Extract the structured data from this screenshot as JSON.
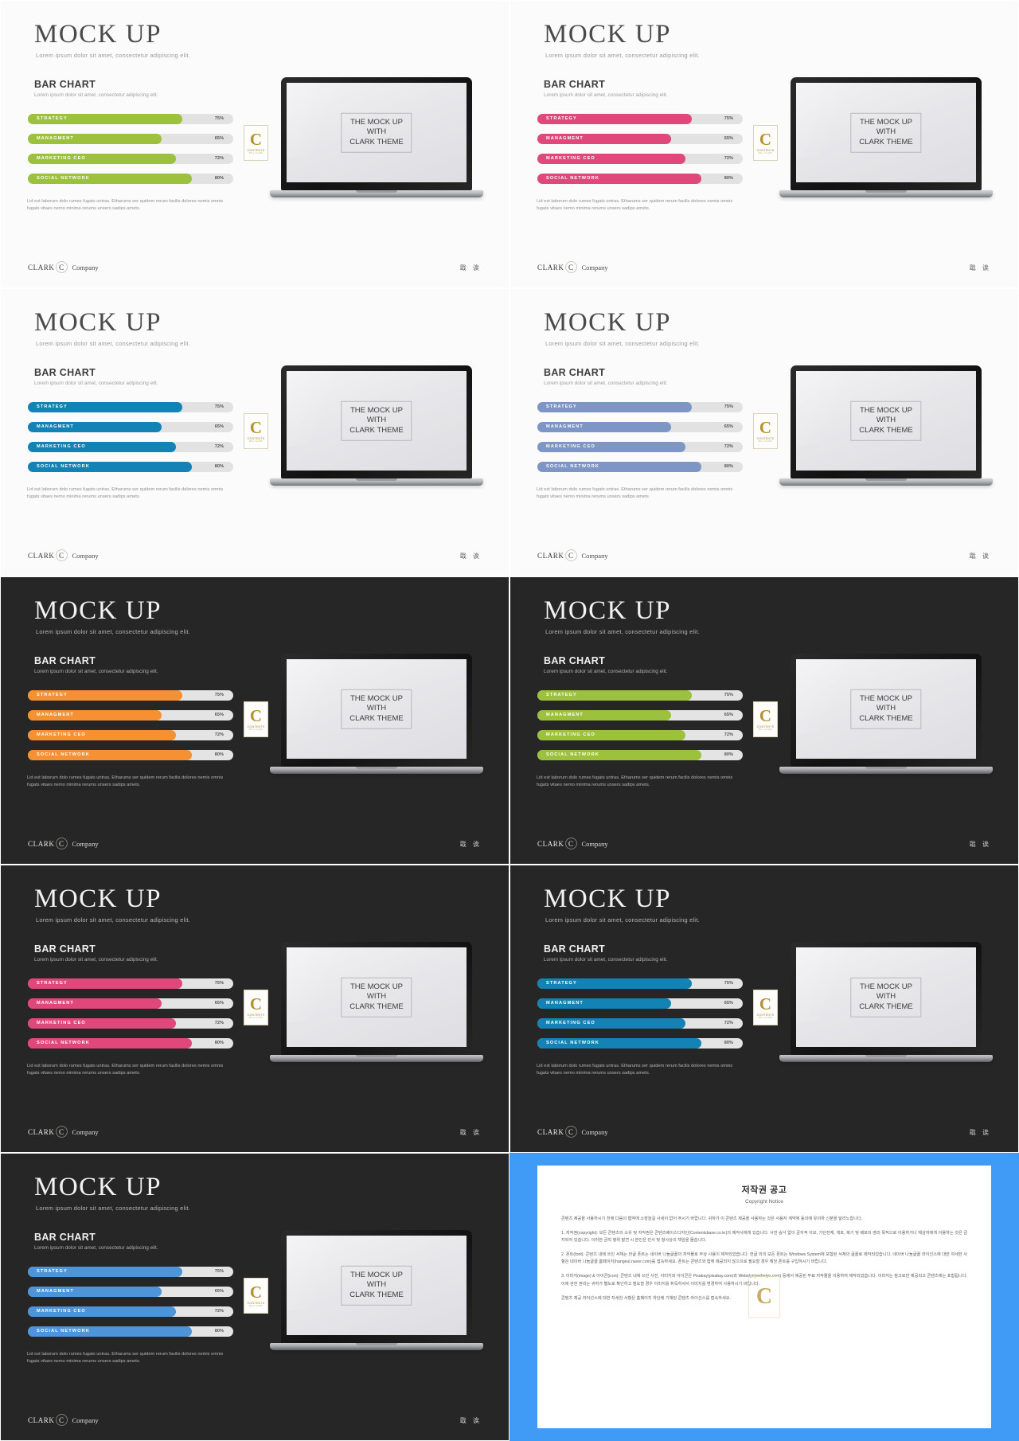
{
  "common": {
    "title": "MOCK UP",
    "subtitle": "Lorem ipsum dolor sit amet, consectetur adipiscing elit.",
    "chart_heading": "BAR CHART",
    "chart_sub": "Lorem ipsum dolor sit amet, consectetur adipiscing elit.",
    "footnote": "Lid est laborum dolo rumes fugats untras. Etharums ser quidem rerum facilis dolores nemis omnis fugats vitaes nemo minima rerums unsers sadips amets.",
    "screen_text": "THE MOCK UP\nWITH\nCLARK THEME",
    "logo_letter": "C",
    "logo_line1": "CONTENTS",
    "logo_line2": "WILL CLARK",
    "footer_brand": "CLARK",
    "footer_mark": "C",
    "footer_company": "Company",
    "footer_right": "戢 诶"
  },
  "chart_data": {
    "type": "bar",
    "title": "BAR CHART",
    "orientation": "horizontal",
    "categories": [
      "STRATEGY",
      "MANAGMENT",
      "MARKETING CEO",
      "SOCIAL NETWORK"
    ],
    "values": [
      75,
      65,
      72,
      80
    ],
    "value_labels": [
      "75%",
      "65%",
      "72%",
      "80%"
    ],
    "xlabel": "",
    "ylabel": "",
    "xlim": [
      0,
      100
    ],
    "grid": false,
    "legend": "none",
    "track_color": "#e2e2e2"
  },
  "slides": [
    {
      "id": "slide-1",
      "theme": "light",
      "accent": "#9cc13c",
      "bg": "#fbfbfb"
    },
    {
      "id": "slide-2",
      "theme": "light",
      "accent": "#e0487b",
      "bg": "#fbfbfb"
    },
    {
      "id": "slide-3",
      "theme": "light",
      "accent": "#1383b5",
      "bg": "#fbfbfb"
    },
    {
      "id": "slide-4",
      "theme": "light",
      "accent": "#7d96c6",
      "bg": "#fbfbfb"
    },
    {
      "id": "slide-5",
      "theme": "dark",
      "accent": "#f59033",
      "bg": "#262626"
    },
    {
      "id": "slide-6",
      "theme": "dark",
      "accent": "#9cc13c",
      "bg": "#262626"
    },
    {
      "id": "slide-7",
      "theme": "dark",
      "accent": "#e0487b",
      "bg": "#262626"
    },
    {
      "id": "slide-8",
      "theme": "dark",
      "accent": "#1383b5",
      "bg": "#262626"
    },
    {
      "id": "slide-9",
      "theme": "dark",
      "accent": "#4e94d8",
      "bg": "#262626"
    }
  ],
  "copyright": {
    "title": "저작권 공고",
    "subtitle": "Copyright Notice",
    "intro": "콘텐츠 제공을 사용하시기 전에 다음의 협약에 소장놀길 사세이 없어 주시기 바랍니다. 귀하가 이 콘텐츠 제공을 사용하는 것은 사용자 계약에 동의에 유의하 신분을 달리노합니다.",
    "p1": "1. 저작권(copyright): 모든 콘텐츠의 소유 및 저작권은 콘텐츠베이스디자인(Contentsbase.co.kr)의 제작사에게 있습니다. 사전 승낙 없이 금지적 이보, 기단전재, 게포, 복기 및 배포의 영리 목적으로 이용하거나 제삼자에게 이용하는 것은 금지되어 있습니다. 이러한 금칙 행위 발견 시 본인은 민사 및 형사상의 책임을 물습니다.",
    "p2": "2. 폰트(font): 콘텐츠 내에 쓰인 서체는 한글 폰트는 네이버 나눔글꼴의 저작물로 무상 사용이 제작되었습니다. 한글 외의 모든 폰트는 Windows System에 포함된 서체의 글꼴로 제작되었습니다. 네이버 나눔글꼴 라이선스에 대한 자세한 사항은 네이버 나눔글꼴 홈페이지(hangeul.naver.com)를 접속하세요. 폰트는 콘텐츠와 함께 제공되지 않으므로 필요할 경우 해당 폰트를 구입하시기 바랍니다.",
    "p3": "3. 이미지(image) & 아이콘(icon): 콘텐츠 내에 쓰인 사진, 이미지와 아이콘은 Pixabay(pixabay.com)와 Webelyn(webelyn.com) 등에서 제공된 무료 저작물을 이용하여 제작되었습니다. 이미지는 참고로만 제공되고 콘텐츠에는 포함됩니다. 이에 관한 권리는 귀하가 별도로 확인하고 필요할 경우 이미지를 취득하셔서 이미지를 변경하여 사용하시기 바랍니다.",
    "closing": "콘텐츠 제공 라이선스에 대한 자세한 사항은 홈페이지 하단에 기재된 콘텐츠 라이선스를 접속하세요."
  }
}
